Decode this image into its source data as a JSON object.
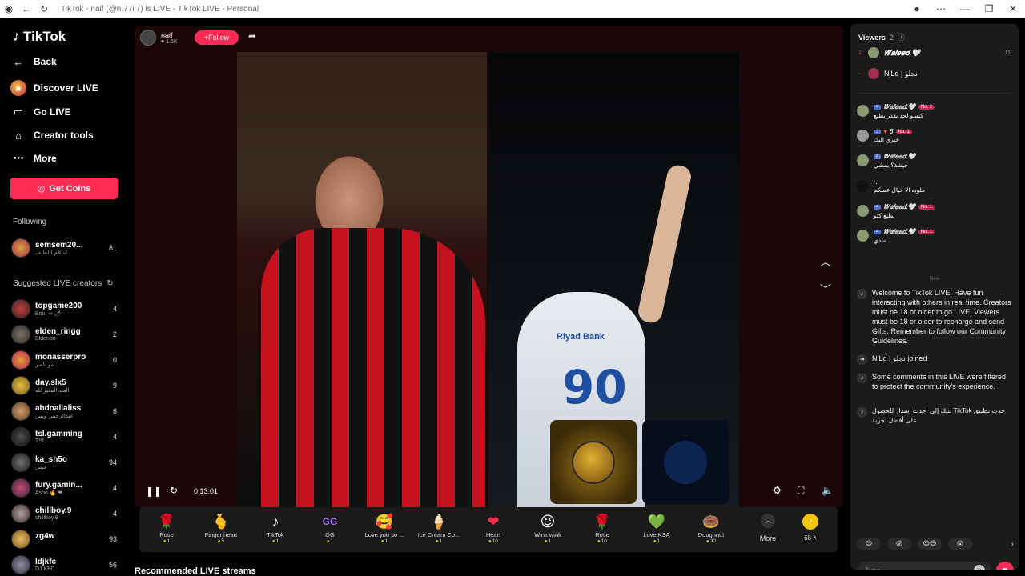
{
  "browser": {
    "title": "TikTok - naif (@n.77ii7) is LIVE - TikTok LIVE - Personal"
  },
  "sidebar": {
    "logo": "TikTok",
    "back": "Back",
    "nav": [
      {
        "label": "Discover LIVE",
        "icon": "discover-icon"
      },
      {
        "label": "Go LIVE",
        "icon": "camera-icon"
      },
      {
        "label": "Creator tools",
        "icon": "home-icon"
      },
      {
        "label": "More",
        "icon": "ellipsis-icon"
      }
    ],
    "coins_label": "Get Coins",
    "following_title": "Following",
    "following": [
      {
        "name": "semsem20...",
        "sub": "اسلام اللطلف",
        "count": "81"
      }
    ],
    "suggested_title": "Suggested LIVE creators",
    "suggested": [
      {
        "name": "topgame200",
        "sub": "Botu ∞ 🌶",
        "count": "4"
      },
      {
        "name": "elden_ringg",
        "sub": "Eldenoo",
        "count": "2"
      },
      {
        "name": "monasserpro",
        "sub": "مو ناصر",
        "count": "10"
      },
      {
        "name": "day.slx5",
        "sub": "العبد الفقير لله",
        "count": "9"
      },
      {
        "name": "abdoallaliss",
        "sub": "عبدالرحمن وبس",
        "count": "6"
      },
      {
        "name": "tsl.gamming",
        "sub": "TSL",
        "count": "4"
      },
      {
        "name": "ka_sh5o",
        "sub": "عبس",
        "count": "94"
      },
      {
        "name": "fury.gamin...",
        "sub": "Asoo 🔥 ❤",
        "count": "4"
      },
      {
        "name": "chillboy.9",
        "sub": "chillboy.9",
        "count": "4"
      },
      {
        "name": "zg4w",
        "sub": "·",
        "count": "93"
      },
      {
        "name": "ldjkfc",
        "sub": "DJ KFC",
        "count": "56"
      }
    ]
  },
  "stream": {
    "host_name": "naif",
    "host_likes": "1.5K",
    "follow_label": "+Follow",
    "time": "0:13:01",
    "jersey_number": "90",
    "sponsor": "Riyad Bank"
  },
  "gifts": [
    {
      "name": "Rose",
      "price": "1",
      "icon": "🌹"
    },
    {
      "name": "Finger heart",
      "price": "5",
      "icon": "🫰"
    },
    {
      "name": "TikTok",
      "price": "1",
      "icon": "♪"
    },
    {
      "name": "GG",
      "price": "1",
      "icon": "GG"
    },
    {
      "name": "Love you so ...",
      "price": "1",
      "icon": "🥰"
    },
    {
      "name": "Ice Cream Co...",
      "price": "1",
      "icon": "🍦"
    },
    {
      "name": "Heart",
      "price": "10",
      "icon": "❤"
    },
    {
      "name": "Wink wink",
      "price": "1",
      "icon": "😉"
    },
    {
      "name": "Rose",
      "price": "10",
      "icon": "🌹"
    },
    {
      "name": "Love KSA",
      "price": "1",
      "icon": "💚"
    },
    {
      "name": "Doughnut",
      "price": "30",
      "icon": "🍩"
    }
  ],
  "gift_more": "More",
  "coin_balance": "68",
  "recommended_title": "Recommended LIVE streams",
  "panel": {
    "viewers_title": "Viewers",
    "viewers_count": "2",
    "viewers": [
      {
        "rank": "1",
        "name": "𝑾𝒂𝒍𝒆𝒆𝒅.🤍",
        "count": "11"
      },
      {
        "rank": "-",
        "name": "NjLo | نجلو",
        "count": ""
      }
    ],
    "comments": [
      {
        "level": "4",
        "name": "𝑾𝒂𝒍𝒆𝒆𝒅.🤍",
        "badge": "No. 2",
        "text": "كيسو لحد يقدر يطلع"
      },
      {
        "level": "3",
        "name": "5",
        "badge": "No. 1",
        "text": "خبري اليك"
      },
      {
        "level": "4",
        "name": "𝑾𝒂𝒍𝒆𝒆𝒅.🤍",
        "badge": "",
        "text": "جيشة؟ يمشي"
      },
      {
        "level": "",
        "name": "·.",
        "badge": "",
        "text": "ملوبه الا خيال عسكم"
      },
      {
        "level": "4",
        "name": "𝑾𝒂𝒍𝒆𝒆𝒅.🤍",
        "badge": "No. 1",
        "text": "يطبع كلو"
      },
      {
        "level": "4",
        "name": "𝑾𝒂𝒍𝒆𝒆𝒅.🤍",
        "badge": "No. 1",
        "text": "صدي"
      }
    ],
    "new_label": "New",
    "system": [
      "Welcome to TikTok LIVE! Have fun interacting with others in real time. Creators must be 18 or older to go LIVE. Viewers must be 18 or older to recharge and send Gifts. Remember to follow our Community Guidelines.",
      "NjLo | نجلو joined",
      "Some comments in this LIVE were filtered to protect the community's experience.",
      "لنيك إلى احدث إسدار للحصول TikTok حدث تطبيق على أفضل تجربة"
    ],
    "type_placeholder": "Type..."
  },
  "colors": {
    "accent": "#fe2c55",
    "coin": "#f5c400"
  }
}
